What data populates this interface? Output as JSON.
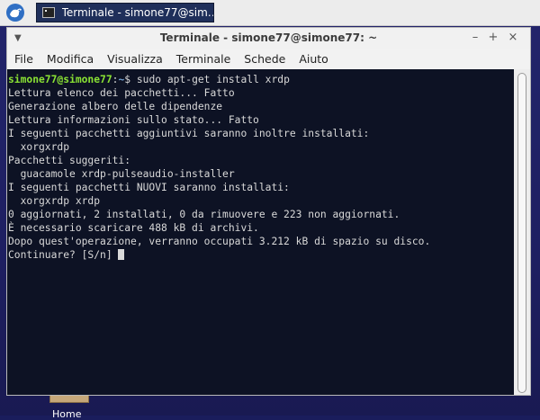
{
  "taskbar": {
    "task_label": "Terminale - simone77@sim…"
  },
  "desktop": {
    "icon_label": "Home"
  },
  "window": {
    "title": "Terminale - simone77@simone77: ~",
    "menu_glyph": "▼",
    "minimize": "–",
    "maximize": "+",
    "close": "×"
  },
  "menubar": {
    "items": [
      "File",
      "Modifica",
      "Visualizza",
      "Terminale",
      "Schede",
      "Aiuto"
    ]
  },
  "terminal": {
    "prompt_user": "simone77@simone77",
    "prompt_sep": ":",
    "prompt_path": "~",
    "prompt_symbol": "$ ",
    "command": "sudo apt-get install xrdp",
    "output": "Lettura elenco dei pacchetti... Fatto\nGenerazione albero delle dipendenze\nLettura informazioni sullo stato... Fatto\nI seguenti pacchetti aggiuntivi saranno inoltre installati:\n  xorgxrdp\nPacchetti suggeriti:\n  guacamole xrdp-pulseaudio-installer\nI seguenti pacchetti NUOVI saranno installati:\n  xorgxrdp xrdp\n0 aggiornati, 2 installati, 0 da rimuovere e 223 non aggiornati.\nÈ necessario scaricare 488 kB di archivi.\nDopo quest'operazione, verranno occupati 3.212 kB di spazio su disco.\nContinuare? [S/n] "
  },
  "colors": {
    "terminal_bg": "#0d1224",
    "terminal_fg": "#d9d9d9",
    "prompt_user": "#8ae234",
    "prompt_path": "#729fcf",
    "taskbar_active": "#1f2f5a"
  }
}
